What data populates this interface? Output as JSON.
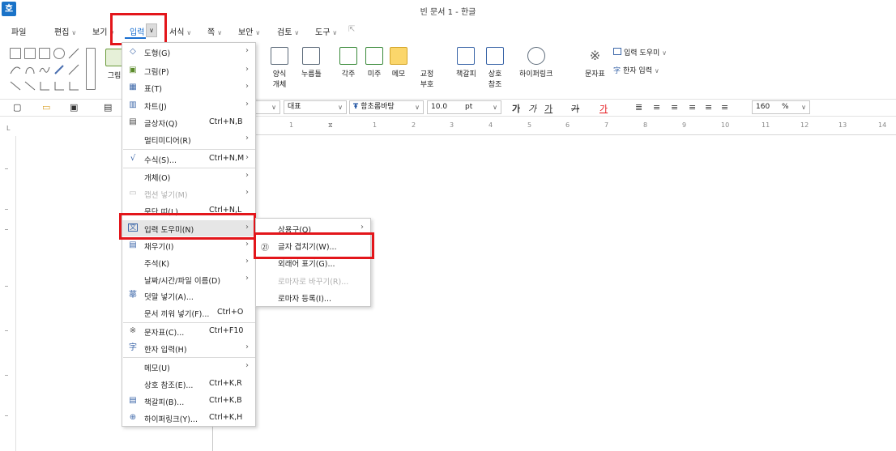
{
  "app": {
    "logo": "호",
    "title": "빈 문서 1 - 한글"
  },
  "menubar": {
    "items": [
      "파일",
      "편집",
      "보기",
      "입력",
      "서식",
      "쪽",
      "보안",
      "검토",
      "도구"
    ],
    "active": "입력"
  },
  "ribbon": {
    "buttons": [
      "그림",
      "양식\n개체",
      "누름틀",
      "각주",
      "미주",
      "메모",
      "교정\n부호",
      "책갈피",
      "상호\n참조",
      "하이퍼링크",
      "문자표"
    ],
    "labels": {
      "form": "양식",
      "form2": "개체",
      "press": "누름틀",
      "footnote": "각주",
      "endnote": "미주",
      "memo": "메모",
      "proof": "교정",
      "proof2": "부호",
      "bookmark": "책갈피",
      "crossref": "상호",
      "crossref2": "참조",
      "hyperlink": "하이퍼링크",
      "charmap": "문자표",
      "picture": "그림",
      "input_helper": "입력 도우미",
      "hanja_input": "한자 입력"
    }
  },
  "format_bar": {
    "style": "대표",
    "font": "함초롬바탕",
    "size": "10.0",
    "unit": "pt",
    "zoom": "160",
    "zoom_unit": "%",
    "bold": "가",
    "italic": "가",
    "underline": "가",
    "strike": "가",
    "color": "가"
  },
  "ruler": {
    "numbers": [
      "1",
      "2",
      "3",
      "4",
      "5",
      "6",
      "7",
      "8",
      "9",
      "10",
      "11",
      "12",
      "13",
      "14"
    ],
    "corner": "L"
  },
  "dropdown": {
    "items": [
      {
        "icon": "shape",
        "label": "도형(G)",
        "shortcut": "",
        "submenu": true
      },
      {
        "icon": "picture",
        "label": "그림(P)",
        "shortcut": "",
        "submenu": true
      },
      {
        "icon": "table",
        "label": "표(T)",
        "shortcut": "",
        "submenu": true
      },
      {
        "icon": "chart",
        "label": "차트(J)",
        "shortcut": "",
        "submenu": true
      },
      {
        "icon": "textbox",
        "label": "글상자(Q)",
        "shortcut": "Ctrl+N,B",
        "submenu": false
      },
      {
        "icon": "",
        "label": "멀티미디어(R)",
        "shortcut": "",
        "submenu": true
      },
      {
        "icon": "formula",
        "label": "수식(S)...",
        "shortcut": "Ctrl+N,M",
        "submenu": true
      },
      {
        "icon": "",
        "label": "개체(O)",
        "shortcut": "",
        "submenu": true
      },
      {
        "icon": "caption",
        "label": "캡션 넣기(M)",
        "shortcut": "",
        "submenu": true
      },
      {
        "icon": "",
        "label": "문단 띠(L)",
        "shortcut": "Ctrl+N,L",
        "submenu": false
      },
      {
        "icon": "input-helper",
        "label": "입력 도우미(N)",
        "shortcut": "",
        "submenu": true
      },
      {
        "icon": "fill",
        "label": "채우기(I)",
        "shortcut": "",
        "submenu": true
      },
      {
        "icon": "",
        "label": "주석(K)",
        "shortcut": "",
        "submenu": true
      },
      {
        "icon": "",
        "label": "날짜/시간/파일 이름(D)",
        "shortcut": "",
        "submenu": true
      },
      {
        "icon": "ruby",
        "label": "덧말 넣기(A)...",
        "shortcut": "",
        "submenu": false
      },
      {
        "icon": "",
        "label": "문서 끼워 넣기(F)...",
        "shortcut": "Ctrl+O",
        "submenu": false
      },
      {
        "icon": "charmap",
        "label": "문자표(C)...",
        "shortcut": "Ctrl+F10",
        "submenu": false
      },
      {
        "icon": "hanja",
        "label": "한자 입력(H)",
        "shortcut": "",
        "submenu": true
      },
      {
        "icon": "",
        "label": "메모(U)",
        "shortcut": "",
        "submenu": true
      },
      {
        "icon": "",
        "label": "상호 참조(E)...",
        "shortcut": "Ctrl+K,R",
        "submenu": false
      },
      {
        "icon": "bookmark",
        "label": "책갈피(B)...",
        "shortcut": "Ctrl+K,B",
        "submenu": false
      },
      {
        "icon": "hyperlink",
        "label": "하이퍼링크(Y)...",
        "shortcut": "Ctrl+K,H",
        "submenu": false
      }
    ]
  },
  "submenu": {
    "items": [
      {
        "label": "상용구(Q)",
        "submenu": true,
        "disabled": false
      },
      {
        "label": "글자 겹치기(W)...",
        "submenu": false,
        "disabled": false
      },
      {
        "label": "외래어 표기(G)...",
        "submenu": false,
        "disabled": false
      },
      {
        "label": "로마자로 바꾸기(R)...",
        "submenu": false,
        "disabled": true
      },
      {
        "label": "로마자 등록(I)...",
        "submenu": false,
        "disabled": false
      }
    ]
  },
  "colors": {
    "highlight": "#e3161b",
    "accent": "#1a6fd0"
  }
}
